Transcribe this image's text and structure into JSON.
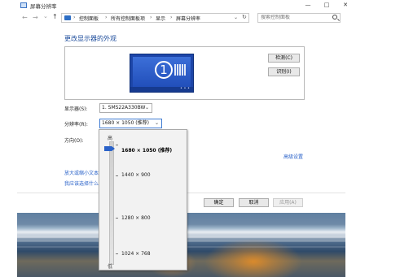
{
  "window": {
    "title": "屏幕分辨率",
    "minimize_glyph": "—",
    "maximize_glyph": "□",
    "close_glyph": "✕"
  },
  "nav": {
    "back_glyph": "←",
    "forward_glyph": "→",
    "recent_glyph": "⌄",
    "up_glyph": "↑",
    "breadcrumb": [
      "控制面板",
      "所有控制面板项",
      "显示",
      "屏幕分辨率"
    ],
    "separator": "›",
    "dropdown_glyph": "⌄",
    "refresh_glyph": "↻",
    "search_placeholder": "搜索控制面板"
  },
  "main": {
    "heading": "更改显示器的外观",
    "monitor_number": "1",
    "detect_button": "检测(C)",
    "identify_button": "识别(I)",
    "display_label": "显示器(S):",
    "display_value": "1. SMS22A330BW",
    "resolution_label": "分辨率(R):",
    "resolution_value": "1680 × 1050 (推荐)",
    "orientation_label": "方向(O):",
    "advanced_link": "高级设置",
    "link_text_size": "放大或缩小文本",
    "link_choose": "我应该选择什么"
  },
  "resolution_dropdown": {
    "high_label": "高",
    "low_label": "低",
    "options": [
      "1680 × 1050 (推荐)",
      "1440 × 900",
      "1280 × 800",
      "1024 × 768"
    ],
    "selected_index": 0,
    "selected_fraction": 1.0
  },
  "buttons": {
    "ok": "确定",
    "cancel": "取消",
    "apply": "应用(A)"
  },
  "icons": {
    "app": "display-settings-icon",
    "address": "control-panel-icon",
    "search": "search-icon"
  }
}
